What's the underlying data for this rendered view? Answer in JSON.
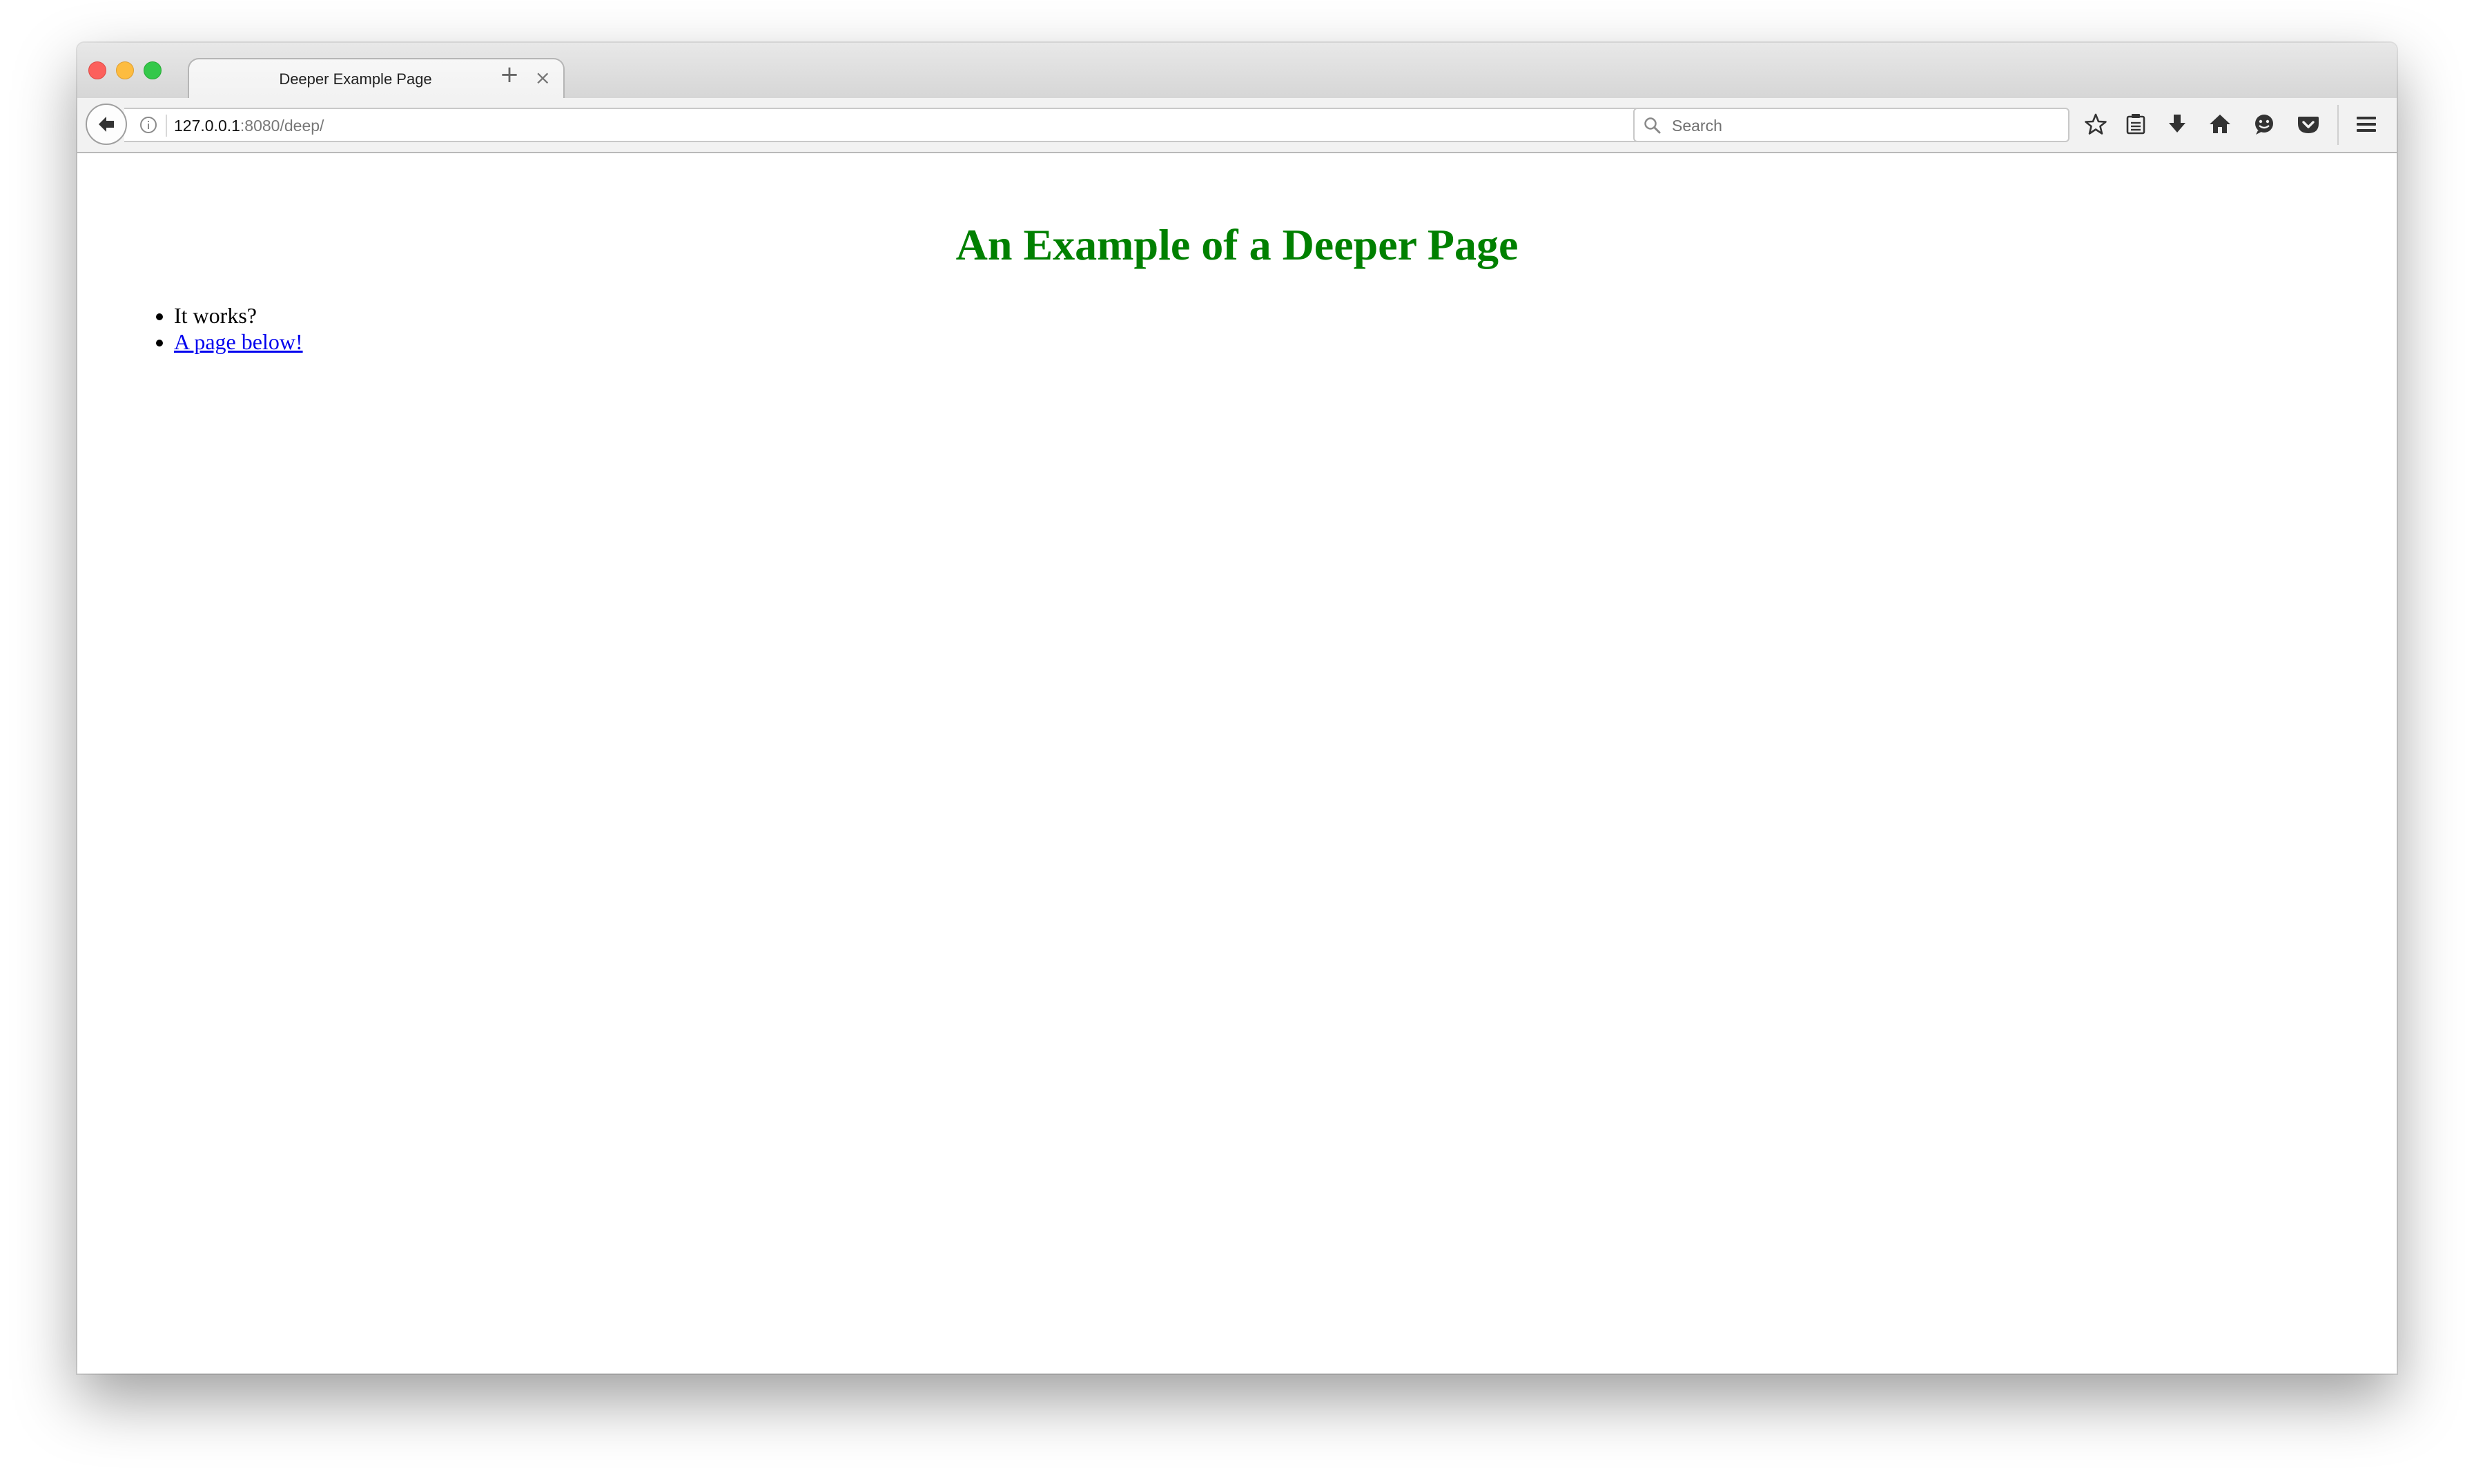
{
  "browser": {
    "tab": {
      "title": "Deeper Example Page",
      "close_glyph": "×"
    },
    "new_tab_glyph": "+",
    "url": {
      "host": "127.0.0.1",
      "path": ":8080/deep/"
    },
    "search": {
      "placeholder": "Search"
    },
    "toolbar_icons": [
      "star-icon",
      "reading-list-icon",
      "download-icon",
      "home-icon",
      "hello-icon",
      "pocket-icon",
      "menu-icon"
    ],
    "traffic_colors": {
      "close": "#fc605c",
      "minimize": "#fdbc40",
      "maximize": "#34c84a"
    }
  },
  "page": {
    "heading": "An Example of a Deeper Page",
    "heading_color": "#008000",
    "items": [
      {
        "text": "It works?",
        "is_link": false
      },
      {
        "text": "A page below!",
        "is_link": true
      }
    ],
    "link_color": "#0000ee"
  }
}
